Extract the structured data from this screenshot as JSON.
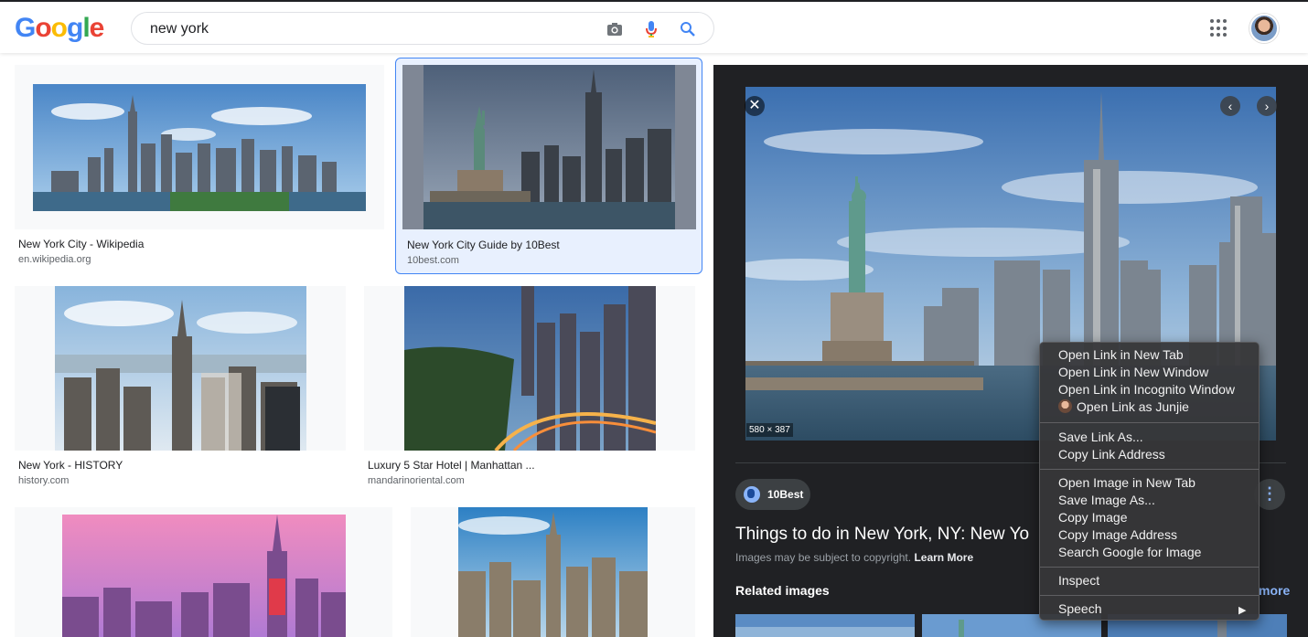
{
  "header": {
    "logo_letters": [
      "G",
      "o",
      "o",
      "g",
      "l",
      "e"
    ],
    "logo_colors": [
      "#4285f4",
      "#ea4335",
      "#fbbc05",
      "#4285f4",
      "#34a853",
      "#ea4335"
    ],
    "search_query": "new york",
    "icons": [
      "camera-icon",
      "microphone-icon",
      "search-icon",
      "apps-grid-icon",
      "avatar"
    ]
  },
  "results": [
    {
      "title": "New York City - Wikipedia",
      "domain": "en.wikipedia.org",
      "selected": false
    },
    {
      "title": "New York City Guide by 10Best",
      "domain": "10best.com",
      "selected": true
    },
    {
      "title": "New York - HISTORY",
      "domain": "history.com",
      "selected": false
    },
    {
      "title": "Luxury 5 Star Hotel | Manhattan ...",
      "domain": "mandarinoriental.com",
      "selected": false
    },
    {
      "title": "",
      "domain": "",
      "selected": false
    },
    {
      "title": "",
      "domain": "",
      "selected": false
    }
  ],
  "preview": {
    "dimensions": "580 × 387",
    "source": "10Best",
    "title": "Things to do in New York, NY: New Yo",
    "copyright_text": "Images may be subject to copyright.",
    "learn_more": "Learn More",
    "related_label": "Related images",
    "view_more": "more",
    "close_symbol": "✕",
    "prev_symbol": "‹",
    "next_symbol": "›",
    "more_symbol": "⋮"
  },
  "context_menu": {
    "groups": [
      [
        "Open Link in New Tab",
        "Open Link in New Window",
        "Open Link in Incognito Window",
        "Open Link as Junjie"
      ],
      [
        "Save Link As...",
        "Copy Link Address"
      ],
      [
        "Open Image in New Tab",
        "Save Image As...",
        "Copy Image",
        "Copy Image Address",
        "Search Google for Image"
      ],
      [
        "Inspect"
      ],
      [
        "Speech"
      ]
    ],
    "submenu_arrow": "▶"
  }
}
